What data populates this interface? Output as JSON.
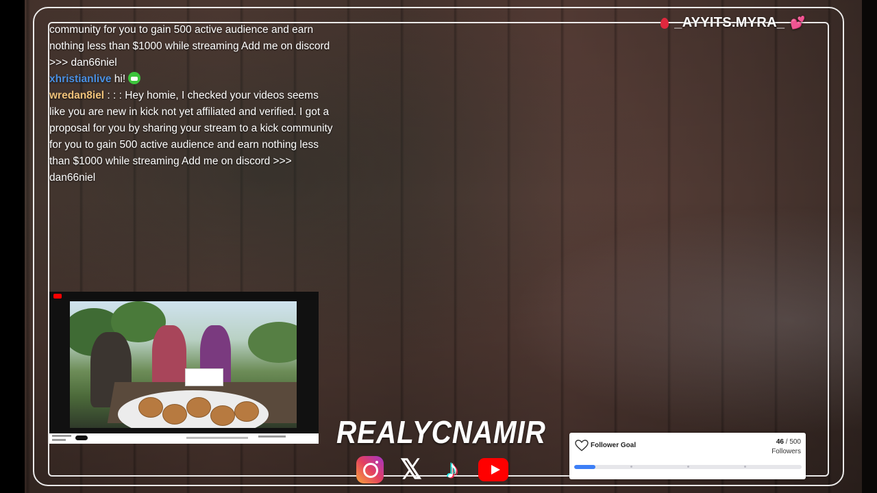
{
  "stream_overlay": {
    "channel_name": "_AYYITS.MYRA_",
    "streamer_brand": "REALYCNAMIR"
  },
  "chat": {
    "messages": [
      {
        "user": "",
        "text": "community for you to gain 500 active audience and earn nothing less than $1000 while streaming Add me on discord >>> dan66niel"
      },
      {
        "user": "xhristianlive",
        "text": " hi!",
        "emote": "green-emote"
      },
      {
        "user": "wredan8iel",
        "text": " : : : Hey homie, I checked your videos seems like you are new in kick not yet affiliated and verified. I got a proposal for you by sharing your stream to a kick community for you to gain 500 active audience and earn nothing less than $1000 while streaming Add me on discord >>> dan66niel"
      }
    ]
  },
  "socials": [
    "instagram-icon",
    "x-icon",
    "tiktok-icon",
    "youtube-icon"
  ],
  "follower_goal": {
    "title": "Follower Goal",
    "current": "46",
    "separator": " / ",
    "target": "500",
    "unit": "Followers",
    "progress": 0.092
  },
  "colors": {
    "accent_blue": "#3d7ff6",
    "chat_user_blue": "#4a90e2",
    "chat_user_gold": "#f0c27a",
    "heart_pink": "#ff5cc6",
    "pin_red": "#e0283e"
  }
}
